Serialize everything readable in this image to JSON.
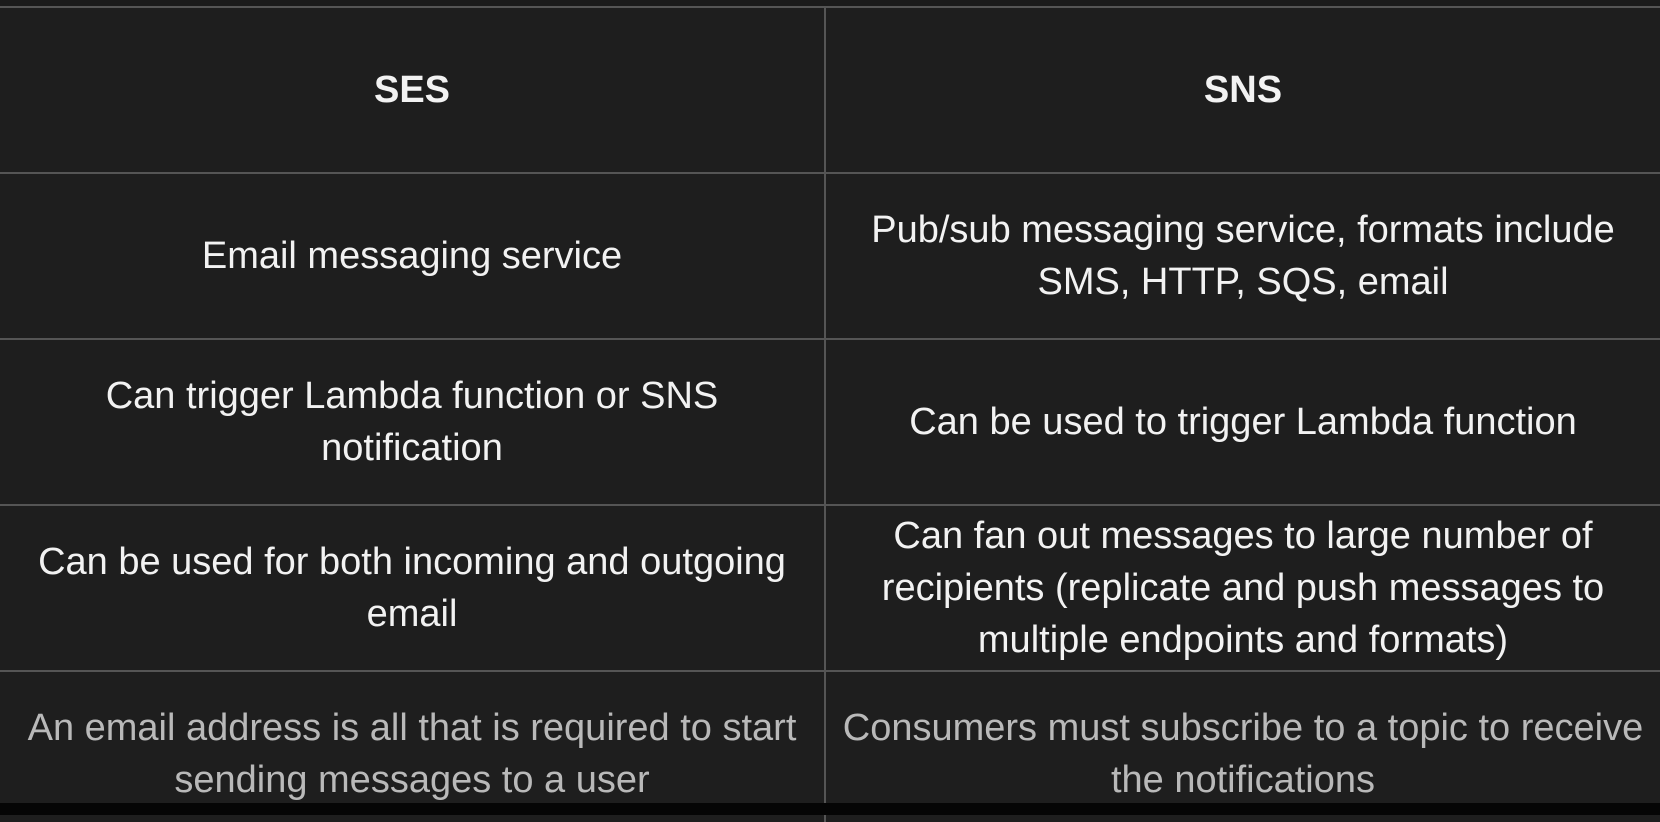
{
  "table": {
    "headers": [
      "SES",
      "SNS"
    ],
    "rows": [
      [
        "Email messaging service",
        "Pub/sub messaging service, formats include SMS, HTTP, SQS, email"
      ],
      [
        "Can trigger Lambda function or SNS notification",
        "Can be used to trigger Lambda function"
      ],
      [
        "Can be used for both incoming and outgoing email",
        "Can fan out messages to large number of recipients (replicate and push messages to multiple endpoints and formats)"
      ],
      [
        "An email address is all that is required to start sending messages to a user",
        "Consumers must subscribe to a topic to receive the notifications"
      ]
    ]
  }
}
